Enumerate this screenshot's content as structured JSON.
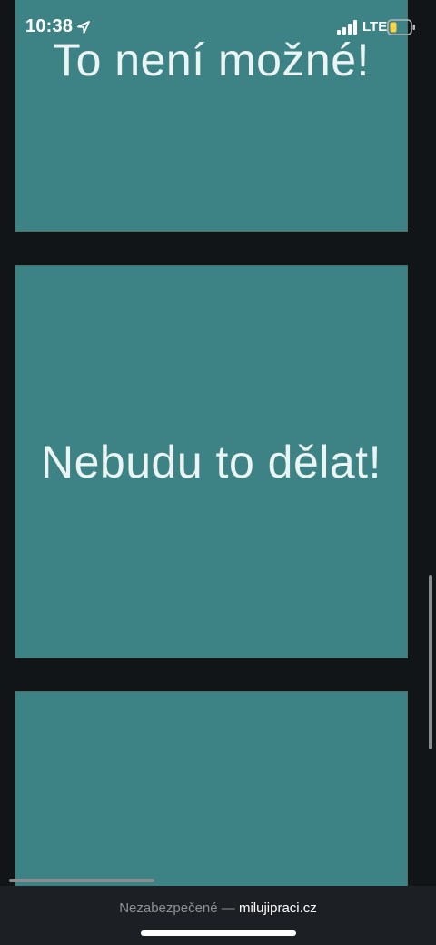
{
  "status_bar": {
    "time": "10:38",
    "network": "LTE",
    "icons": [
      "location-arrow-icon",
      "cellular-signal-icon",
      "battery-low-icon"
    ],
    "battery_color": "#f5d547"
  },
  "cards": [
    {
      "text": "To není možné!"
    },
    {
      "text": "Nebudu to dělat!"
    },
    {
      "text": ""
    }
  ],
  "colors": {
    "background": "#121518",
    "card": "#3d8385",
    "card_text": "#eaf4f3"
  },
  "browser": {
    "security_label": "Nezabezpečené —",
    "domain": "milujipraci.cz"
  }
}
